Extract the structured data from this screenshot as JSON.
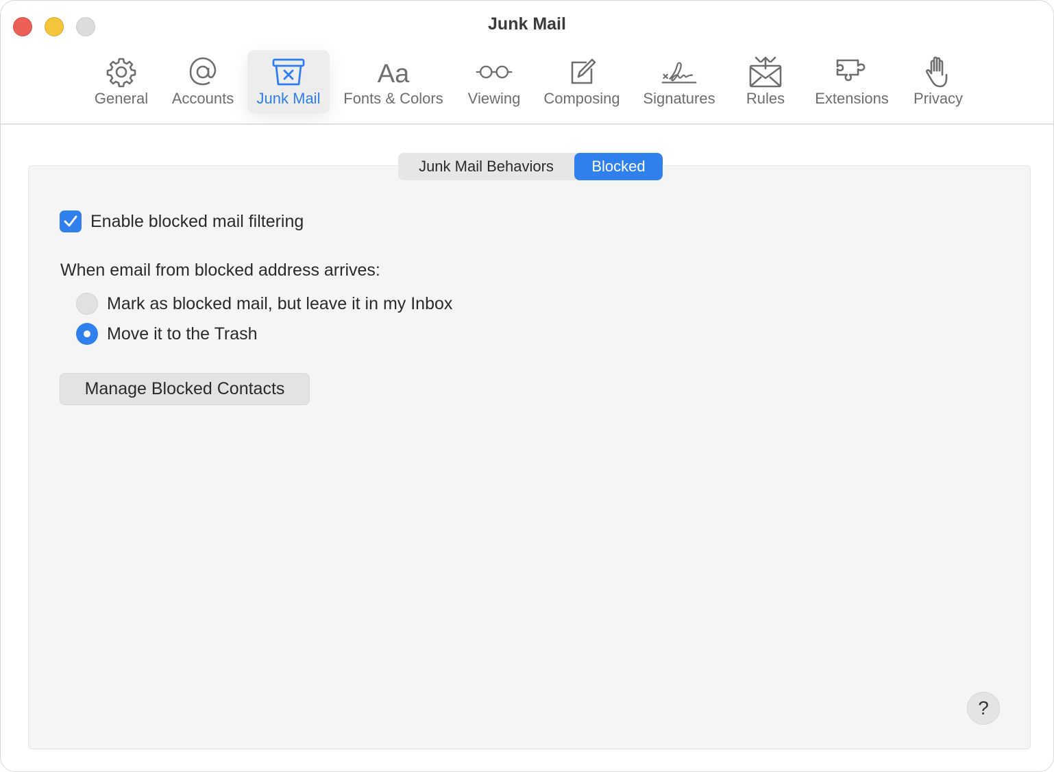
{
  "window": {
    "title": "Junk Mail"
  },
  "toolbar": {
    "tabs": [
      {
        "label": "General",
        "icon": "gear-icon"
      },
      {
        "label": "Accounts",
        "icon": "at-icon"
      },
      {
        "label": "Junk Mail",
        "icon": "junk-tray-icon",
        "active": true
      },
      {
        "label": "Fonts & Colors",
        "icon": "font-aa-icon"
      },
      {
        "label": "Viewing",
        "icon": "glasses-icon"
      },
      {
        "label": "Composing",
        "icon": "compose-icon"
      },
      {
        "label": "Signatures",
        "icon": "signature-icon"
      },
      {
        "label": "Rules",
        "icon": "envelope-rules-icon"
      },
      {
        "label": "Extensions",
        "icon": "puzzle-icon"
      },
      {
        "label": "Privacy",
        "icon": "hand-icon"
      }
    ]
  },
  "segmented": {
    "behaviors": "Junk Mail Behaviors",
    "blocked": "Blocked",
    "selected": "Blocked"
  },
  "blocked": {
    "enable_label": "Enable blocked mail filtering",
    "enable_checked": true,
    "question": "When email from blocked address arrives:",
    "options": [
      {
        "label": "Mark as blocked mail, but leave it in my Inbox",
        "selected": false
      },
      {
        "label": "Move it to the Trash",
        "selected": true
      }
    ],
    "manage_button": "Manage Blocked Contacts",
    "help": "?"
  },
  "colors": {
    "accent": "#2f80ed",
    "close": "#ec5f57",
    "minimize": "#f4c43a",
    "zoom": "#dcdcdc"
  }
}
